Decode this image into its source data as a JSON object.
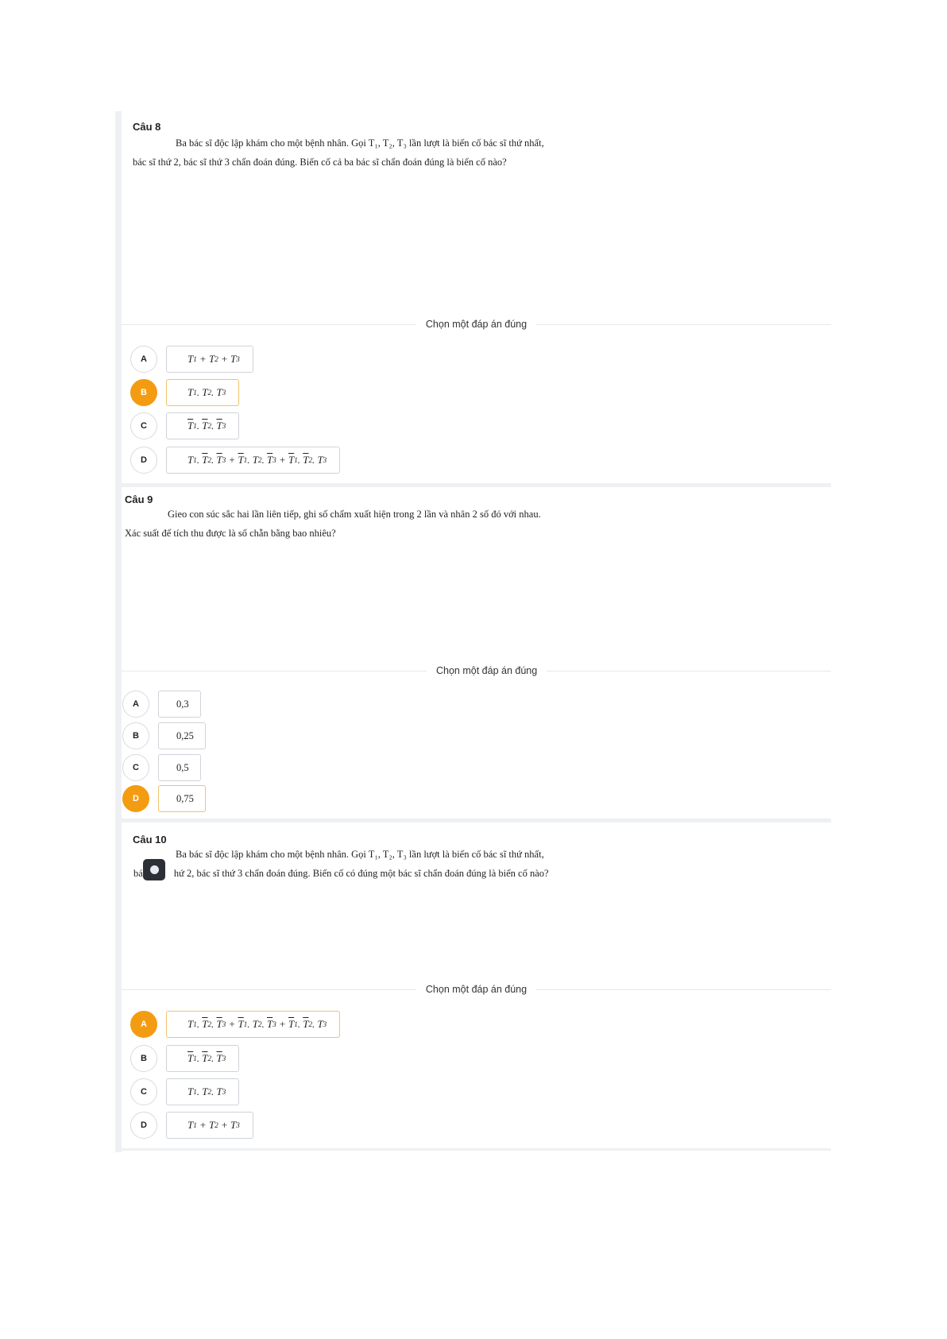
{
  "questions": [
    {
      "label": "Câu 8",
      "line1": "Ba bác sĩ độc lập khám cho một bệnh nhân. Gọi T₁, T₂, T₃ lần lượt là biến cố bác sĩ thứ nhất,",
      "line2": "bác sĩ thứ 2, bác sĩ thứ 3 chẩn đoán đúng. Biến cố cả ba bác sĩ chẩn đoán đúng là biến cố nào?",
      "prompt": "Chọn một đáp án đúng",
      "selected": "B",
      "options": [
        {
          "letter": "A",
          "text": "T₁ + T₂ + T₃"
        },
        {
          "letter": "B",
          "text": "T₁. T₂. T₃"
        },
        {
          "letter": "C",
          "text": "T̄₁. T̄₂. T̄₃"
        },
        {
          "letter": "D",
          "text": "T₁. T̄₂. T̄₃ + T̄₁. T₂. T̄₃ + T̄₁. T̄₂. T₃"
        }
      ]
    },
    {
      "label": "Câu 9",
      "line1": "Gieo con súc sắc hai lần liên tiếp, ghi số chấm xuất hiện trong 2 lần và nhân 2 số đó với nhau.",
      "line2": "Xác suất để tích thu được là số chẵn bằng bao nhiêu?",
      "prompt": "Chọn một đáp án đúng",
      "selected": "D",
      "options": [
        {
          "letter": "A",
          "text": "0,3"
        },
        {
          "letter": "B",
          "text": "0,25"
        },
        {
          "letter": "C",
          "text": "0,5"
        },
        {
          "letter": "D",
          "text": "0,75"
        }
      ]
    },
    {
      "label": "Câu 10",
      "line1": "Ba bác sĩ độc lập khám cho một bệnh nhân. Gọi T₁, T₂, T₃ lần lượt là biến cố bác sĩ thứ nhất,",
      "line2_start": "bá",
      "line2_end": "hứ 2, bác sĩ thứ 3 chẩn đoán đúng. Biến cố có đúng một bác sĩ chẩn đoán đúng là biến cố nào?",
      "prompt": "Chọn một đáp án đúng",
      "selected": "A",
      "options": [
        {
          "letter": "A",
          "text": "T₁. T̄₂. T̄₃ + T̄₁. T₂. T̄₃ + T̄₁. T̄₂. T₃"
        },
        {
          "letter": "B",
          "text": "T̄₁. T̄₂. T̄₃"
        },
        {
          "letter": "C",
          "text": "T₁. T₂. T₃"
        },
        {
          "letter": "D",
          "text": "T₁ + T₂ + T₃"
        }
      ]
    }
  ],
  "overlay_icon": "brain-icon",
  "colors": {
    "accent": "#f39c12",
    "selected_border": "#f0c36d",
    "rail": "#eef0f3"
  }
}
